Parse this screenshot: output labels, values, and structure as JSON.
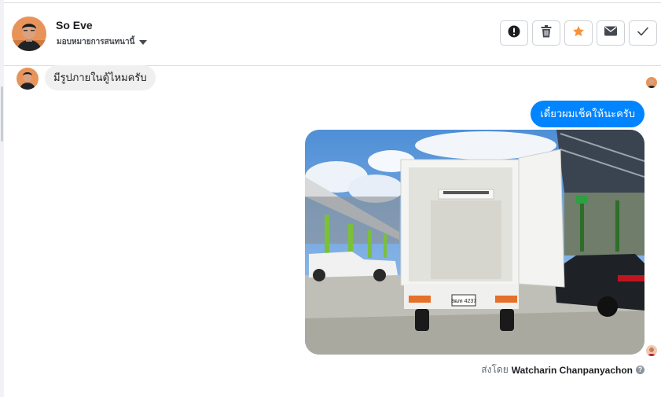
{
  "contact": {
    "name": "So Eve",
    "assign_label": "มอบหมายการสนทนานี้"
  },
  "actions": [
    {
      "icon": "alert-icon"
    },
    {
      "icon": "trash-icon"
    },
    {
      "icon": "star-icon",
      "color": "#f7923b"
    },
    {
      "icon": "mail-icon"
    },
    {
      "icon": "check-icon"
    }
  ],
  "messages": {
    "incoming_text": "มีรูปภายในตู้ไหมครับ",
    "outgoing_text": "เดี๋ยวผมเช็คให้นะครับ",
    "photo_plate": "3ฒท 4237"
  },
  "sent_by": {
    "prefix": "ส่งโดย",
    "name": "Watcharin Chanpanyachon",
    "help": "?"
  },
  "colors": {
    "outgoing_bubble": "#0084ff",
    "incoming_bubble": "#f0f0f0"
  }
}
